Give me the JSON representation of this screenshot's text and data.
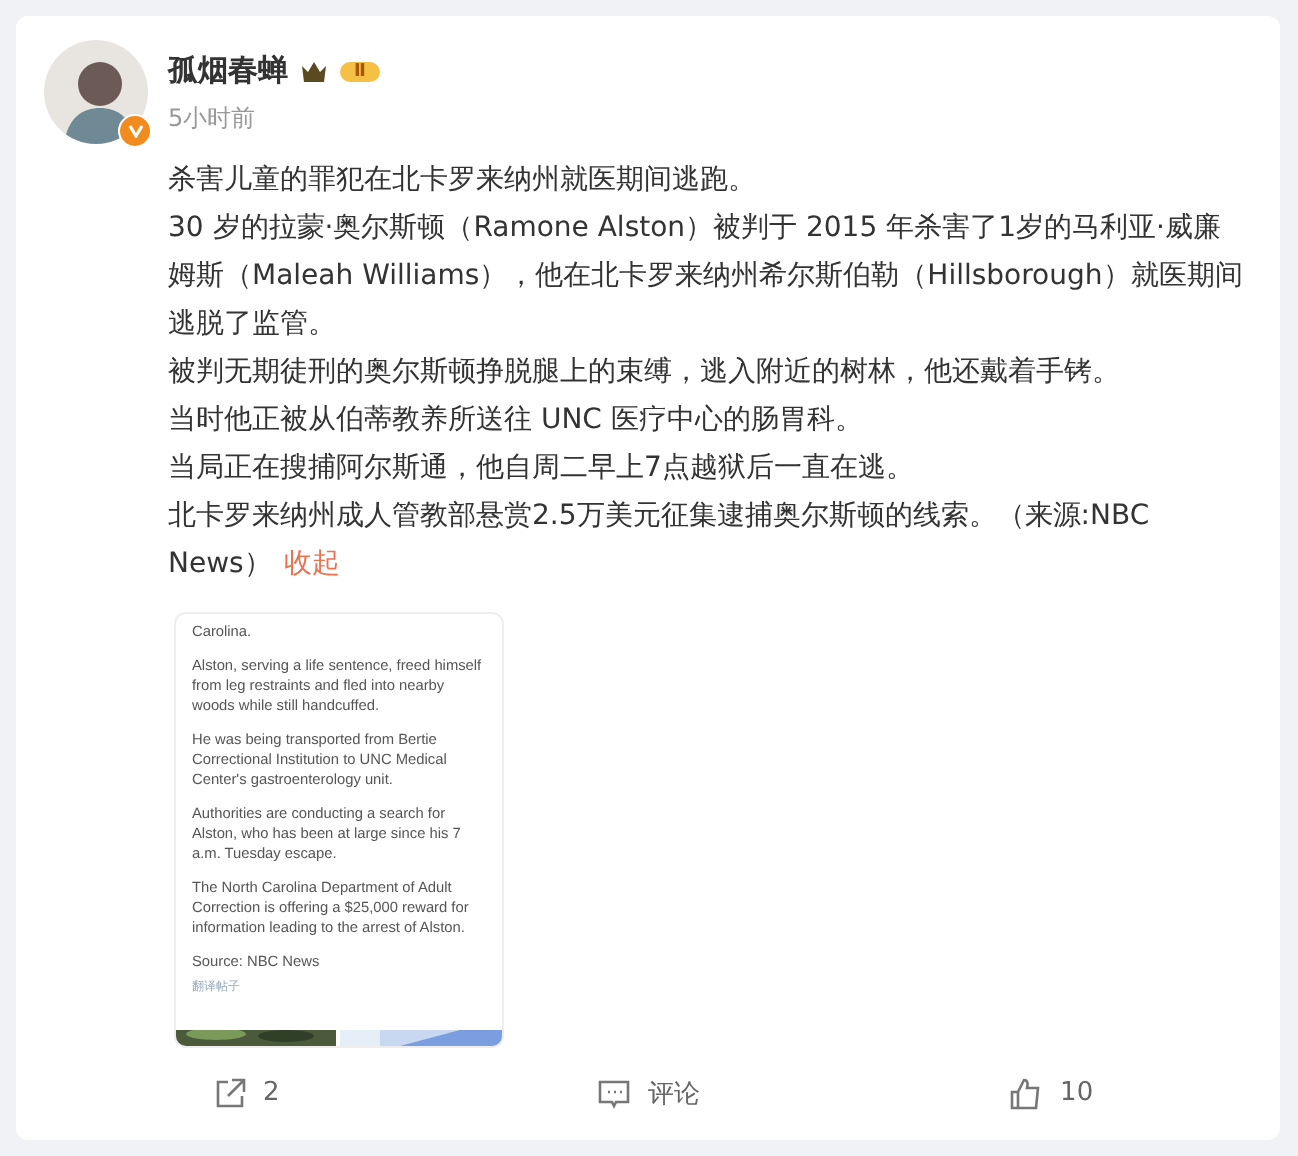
{
  "author": {
    "name": "孤烟春蝉",
    "level_badge": "Ⅱ",
    "verified": true,
    "time": "5小时前"
  },
  "post": {
    "paragraphs": [
      "杀害儿童的罪犯在北卡罗来纳州就医期间逃跑。",
      "30 岁的拉蒙·奥尔斯顿（Ramone Alston）被判于 2015 年杀害了1岁的马利亚·威廉姆斯（Maleah Williams），他在北卡罗来纳州希尔斯伯勒（Hillsborough）就医期间逃脱了监管。",
      "被判无期徒刑的奥尔斯顿挣脱腿上的束缚，逃入附近的树林，他还戴着手铐。",
      "当时他正被从伯蒂教养所送往 UNC 医疗中心的肠胃科。",
      "当局正在搜捕阿尔斯通，他自周二早上7点越狱后一直在逃。",
      "北卡罗来纳州成人管教部悬赏2.5万美元征集逮捕奥尔斯顿的线索。（来源:NBC News）"
    ],
    "collapse_link": "收起"
  },
  "attachment": {
    "paragraphs": [
      "Carolina.",
      "Alston, serving a life sentence, freed himself from leg restraints and fled into nearby woods while still handcuffed.",
      "He was being transported from Bertie Correctional Institution to UNC Medical Center's gastroenterology unit.",
      "Authorities are conducting a search for Alston, who has been at large since his 7 a.m. Tuesday escape.",
      "The North Carolina Department of Adult Correction is offering a $25,000 reward for information leading to the arrest of Alston.",
      "Source: NBC News"
    ],
    "translate_link": "翻译帖子"
  },
  "actions": [
    {
      "kind": "share",
      "label": "2"
    },
    {
      "kind": "comment",
      "label": "评论"
    },
    {
      "kind": "like",
      "label": "10"
    }
  ]
}
